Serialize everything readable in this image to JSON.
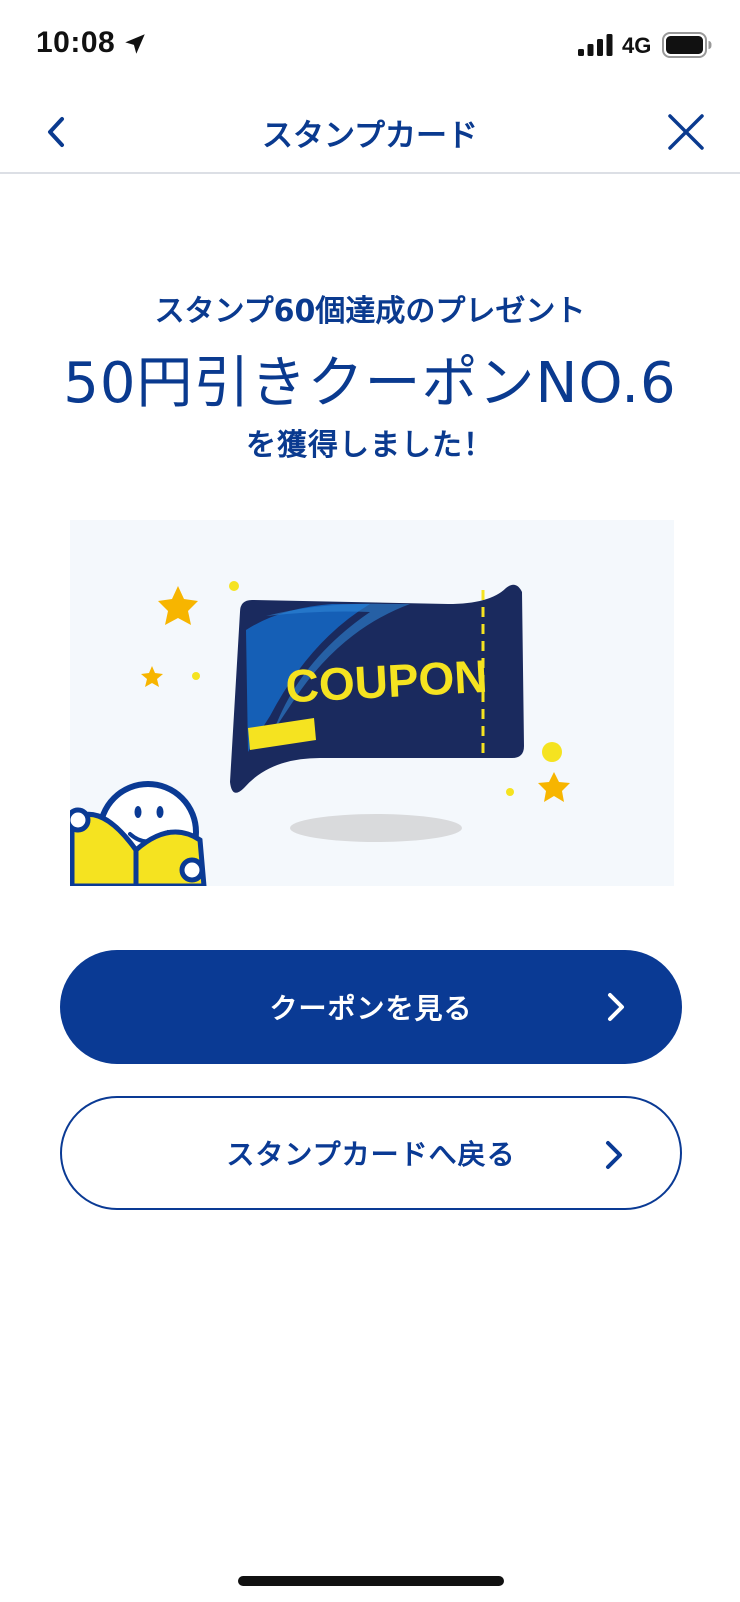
{
  "status_bar": {
    "time": "10:08",
    "network": "4G",
    "icons": [
      "location-arrow-icon",
      "cellular-signal-icon",
      "battery-icon"
    ]
  },
  "nav": {
    "title": "スタンプカード",
    "back_icon": "chevron-left-icon",
    "close_icon": "close-icon"
  },
  "headline": {
    "sub": "スタンプ60個達成のプレゼント",
    "main": "50円引きクーポンNO.6",
    "end": "を獲得しました！"
  },
  "illustration": {
    "coupon_text": "COUPON"
  },
  "buttons": {
    "view_coupon": "クーポンを見る",
    "back_to_card": "スタンプカードへ戻る"
  },
  "colors": {
    "brand_blue": "#0a3a94",
    "coupon_navy": "#1a2a5e",
    "coupon_yellow": "#f5e320",
    "star_gold": "#f7b500"
  }
}
